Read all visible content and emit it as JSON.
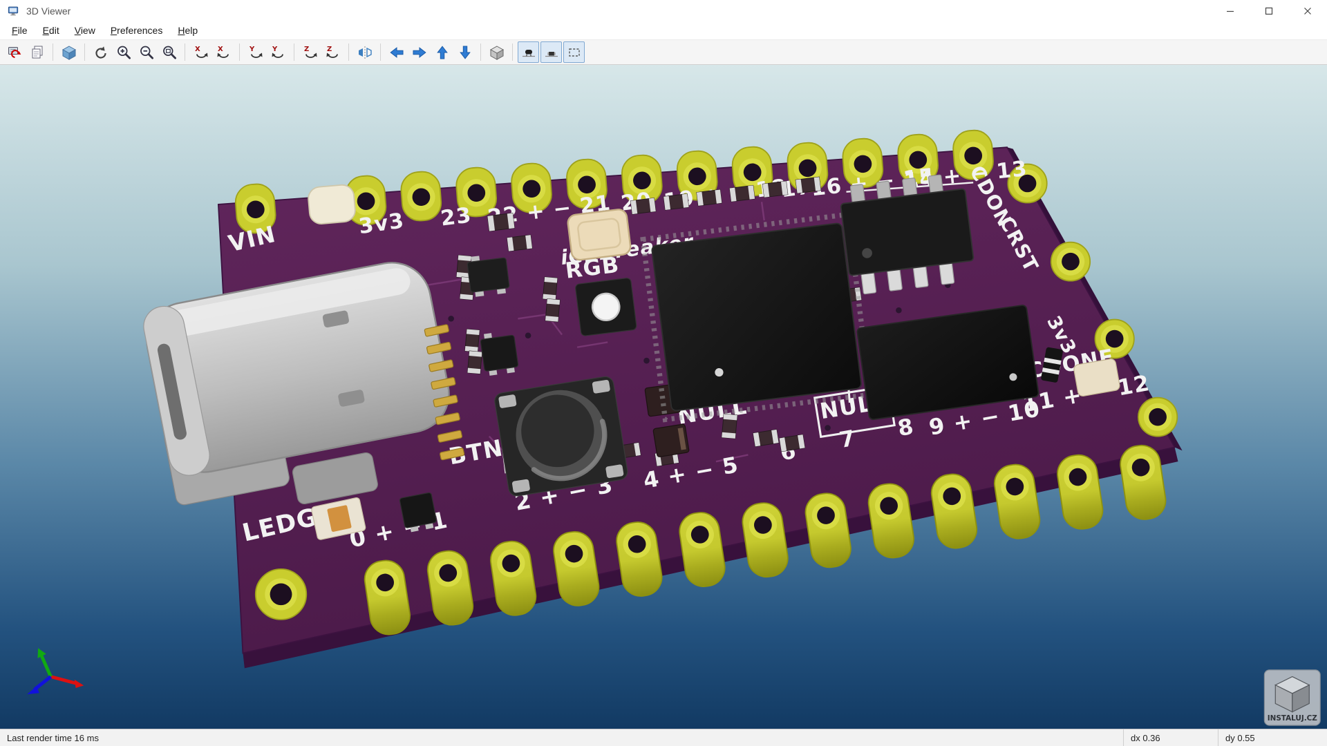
{
  "window": {
    "title": "3D Viewer"
  },
  "menubar": {
    "items": [
      "File",
      "Edit",
      "View",
      "Preferences",
      "Help"
    ]
  },
  "toolbar": {
    "groups": [
      [
        {
          "icon": "reload-board-icon"
        },
        {
          "icon": "copy-image-icon"
        }
      ],
      [
        {
          "icon": "view-3d-properties-icon"
        }
      ],
      [
        {
          "icon": "redraw-icon"
        },
        {
          "icon": "zoom-in-icon"
        },
        {
          "icon": "zoom-out-icon"
        },
        {
          "icon": "zoom-fit-icon"
        }
      ],
      [
        {
          "icon": "rotate-x-cw-icon"
        },
        {
          "icon": "rotate-x-ccw-icon"
        }
      ],
      [
        {
          "icon": "rotate-y-cw-icon"
        },
        {
          "icon": "rotate-y-ccw-icon"
        }
      ],
      [
        {
          "icon": "rotate-z-cw-icon"
        },
        {
          "icon": "rotate-z-ccw-icon"
        }
      ],
      [
        {
          "icon": "flip-board-icon"
        }
      ],
      [
        {
          "icon": "pan-left-icon"
        },
        {
          "icon": "pan-right-icon"
        },
        {
          "icon": "pan-up-icon"
        },
        {
          "icon": "pan-down-icon"
        }
      ],
      [
        {
          "icon": "ortho-projection-icon"
        }
      ],
      [
        {
          "icon": "show-th-models-icon",
          "active": true
        },
        {
          "icon": "show-smd-models-icon",
          "active": true
        },
        {
          "icon": "show-virtual-models-icon",
          "active": true
        }
      ]
    ]
  },
  "viewport": {
    "silkscreen": {
      "top": [
        "VIN",
        "3v3",
        "23",
        "22 + − 21",
        "20",
        "19 + − 18",
        "17",
        "16 + − 15",
        "14 + − 13"
      ],
      "middle": [
        "iCEBreaker",
        "RGB",
        "BTN",
        "NULL",
        "NULL",
        "CDONE"
      ],
      "bottom": [
        "LEDG",
        "0 + − 1",
        "2 + − 3",
        "4 + − 5",
        "6",
        "7",
        "8",
        "9 + − 10",
        "11 + − 12"
      ],
      "right": [
        "CDON",
        "CRST",
        "3v3"
      ]
    },
    "colors": {
      "board": "#571f55",
      "pads": "#c9cd2e",
      "background_top": "#d7e7e9",
      "background_bottom": "#123a63",
      "axis_x": "#dd1111",
      "axis_y": "#11aa11",
      "axis_z": "#1111dd"
    }
  },
  "watermark": {
    "text": "INSTALUJ.CZ"
  },
  "statusbar": {
    "render_time": "Last render time 16 ms",
    "dx": "dx 0.36",
    "dy": "dy 0.55"
  }
}
